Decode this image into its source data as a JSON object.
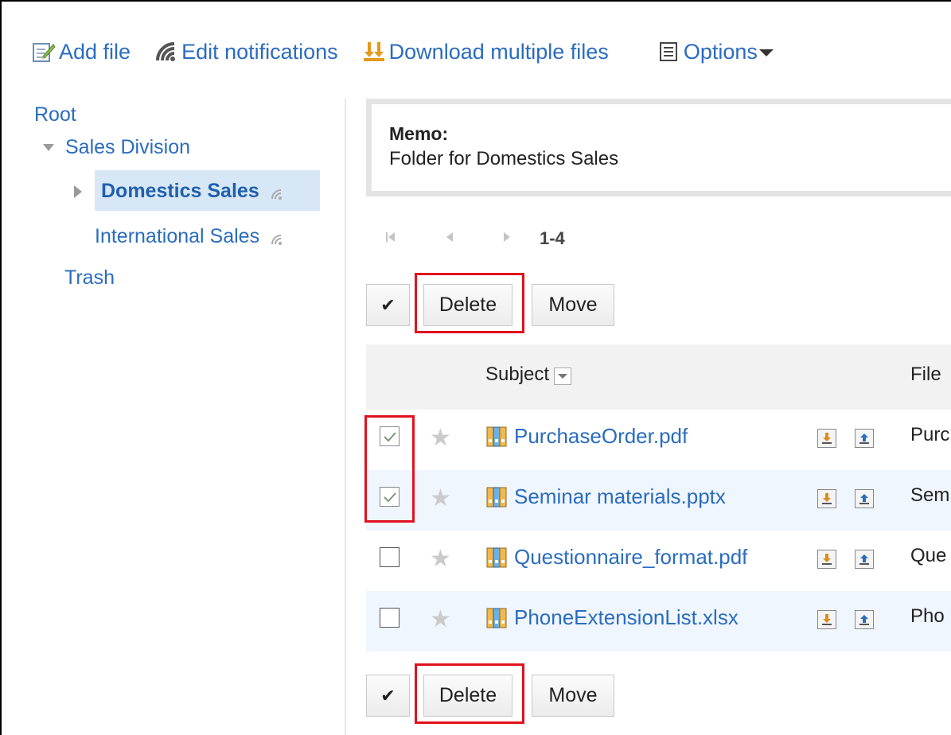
{
  "toolbar": {
    "add_file": "Add file",
    "edit_notifications": "Edit notifications",
    "download_multiple": "Download multiple files",
    "options": "Options"
  },
  "tree": {
    "root": "Root",
    "sales_division": "Sales Division",
    "domestics_sales": "Domestics Sales",
    "international_sales": "International Sales",
    "trash": "Trash"
  },
  "memo": {
    "title": "Memo:",
    "text": "Folder for Domestics Sales"
  },
  "pager": {
    "range": "1-4"
  },
  "actions": {
    "check": "✔",
    "delete": "Delete",
    "move": "Move"
  },
  "table": {
    "headers": {
      "subject": "Subject",
      "file_title": "File"
    },
    "rows": [
      {
        "name": "PurchaseOrder.pdf",
        "title": "Purc",
        "checked": true
      },
      {
        "name": "Seminar materials.pptx",
        "title": "Sem",
        "checked": true
      },
      {
        "name": "Questionnaire_format.pdf",
        "title": "Que",
        "checked": false
      },
      {
        "name": "PhoneExtensionList.xlsx",
        "title": "Pho",
        "checked": false
      }
    ]
  },
  "colors": {
    "link": "#2a6cbf",
    "highlight": "#e0121d",
    "selected_bg": "#d7e7f5",
    "row_alt_bg": "#f0f6fd"
  },
  "icons": [
    "edit-note-icon",
    "notification-icon",
    "download-multiple-icon",
    "options-list-icon",
    "binder-icon",
    "download-icon",
    "upload-icon",
    "star-icon"
  ]
}
